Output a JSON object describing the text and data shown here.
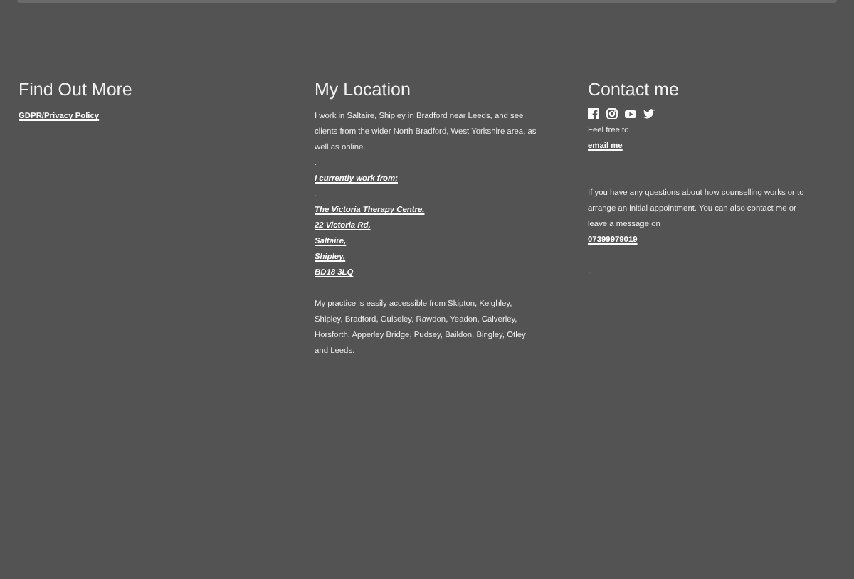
{
  "columns": [
    {
      "heading": "Find Out More",
      "blocks": [
        {
          "kind": "link",
          "text": "GDPR/Privacy Policy"
        }
      ]
    },
    {
      "heading": "My Location",
      "blocks": [
        {
          "kind": "para",
          "text": "I work in Saltaire, Shipley in Bradford near Leeds, and see clients from the wider North Bradford, West Yorkshire area, as well as online."
        },
        {
          "kind": "dot",
          "text": "."
        },
        {
          "kind": "italic",
          "text": "I currently work from;"
        },
        {
          "kind": "dot",
          "text": "."
        },
        {
          "kind": "italic",
          "text": "The Victoria Therapy Centre,"
        },
        {
          "kind": "italic",
          "text": "22 Victoria Rd,"
        },
        {
          "kind": "italic",
          "text": "Saltaire,"
        },
        {
          "kind": "italic",
          "text": "Shipley,"
        },
        {
          "kind": "italic",
          "text": "BD18 3LQ"
        },
        {
          "kind": "gap"
        },
        {
          "kind": "para",
          "text": "My practice is easily accessible from Skipton, Keighley, Shipley, Bradford, Guiseley, Rawdon, Yeadon, Calverley, Horsforth, Apperley Bridge, Pudsey, Baildon, Bingley, Otley and Leeds."
        }
      ]
    },
    {
      "heading": "Contact me",
      "social": true,
      "blocks": [
        {
          "kind": "para",
          "text": "Feel free to"
        },
        {
          "kind": "link",
          "text": "email me"
        },
        {
          "kind": "gap"
        },
        {
          "kind": "gap"
        },
        {
          "kind": "para",
          "text": "If you have any questions about how counselling works or to arrange an initial appointment. You can also contact me or leave a message on"
        },
        {
          "kind": "link",
          "text": "07399979019"
        },
        {
          "kind": "gap"
        },
        {
          "kind": "dot",
          "text": "."
        }
      ]
    }
  ]
}
